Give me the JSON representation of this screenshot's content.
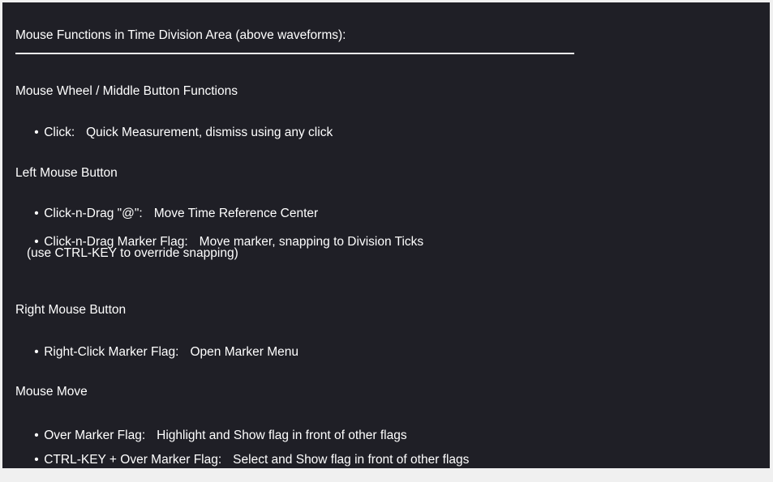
{
  "title": "Mouse Functions in Time Division Area (above waveforms):",
  "sections": [
    {
      "heading": "Mouse Wheel / Middle Button Functions",
      "items": [
        {
          "bullet": "•",
          "action": "Click:",
          "description": "Quick Measurement, dismiss using any click"
        }
      ]
    },
    {
      "heading": "Left Mouse Button",
      "items": [
        {
          "bullet": "•",
          "action": "Click-n-Drag \"@\":",
          "description": "Move Time Reference Center"
        },
        {
          "bullet": "•",
          "action": "Click-n-Drag Marker Flag:",
          "description": "Move marker, snapping to Division Ticks"
        }
      ],
      "note": "(use CTRL-KEY to override snapping)"
    },
    {
      "heading": "Right Mouse Button",
      "items": [
        {
          "bullet": "•",
          "action": "Right-Click Marker Flag:",
          "description": "Open Marker Menu"
        }
      ]
    },
    {
      "heading": "Mouse Move",
      "items": [
        {
          "bullet": "•",
          "action": "Over Marker Flag:",
          "description": "Highlight and Show flag in front of other flags"
        },
        {
          "bullet": "•",
          "action": "CTRL-KEY + Over Marker Flag:",
          "description": "Select and Show flag in front of other flags"
        }
      ]
    }
  ]
}
